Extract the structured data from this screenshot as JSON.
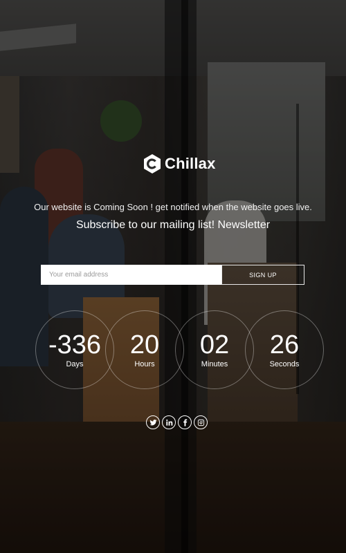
{
  "brand": {
    "name": "Chillax"
  },
  "tagline": "Our website is Coming Soon ! get notified when the website goes live.",
  "subscribe_heading": "Subscribe to our mailing list! Newsletter",
  "form": {
    "email_placeholder": "Your email address",
    "email_value": "",
    "signup_label": "SIGN UP"
  },
  "countdown": [
    {
      "value": "-336",
      "label": "Days"
    },
    {
      "value": "20",
      "label": "Hours"
    },
    {
      "value": "02",
      "label": "Minutes"
    },
    {
      "value": "26",
      "label": "Seconds"
    }
  ],
  "social": [
    {
      "icon": "twitter-icon"
    },
    {
      "icon": "linkedin-icon"
    },
    {
      "icon": "facebook-icon"
    },
    {
      "icon": "instagram-icon"
    }
  ],
  "colors": {
    "overlay": "#000000",
    "text": "#ffffff",
    "input_bg": "#ffffff"
  }
}
